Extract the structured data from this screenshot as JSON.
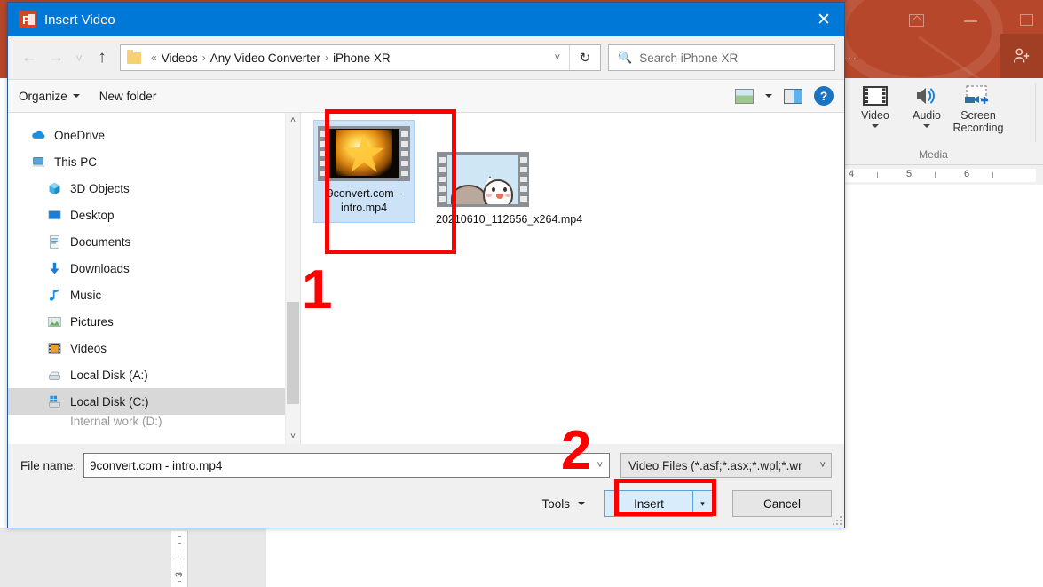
{
  "powerpoint": {
    "ribbon": {
      "group_label": "Media",
      "buttons": [
        {
          "label": "Video",
          "icon": "video-icon",
          "has_caret": true
        },
        {
          "label": "Audio",
          "icon": "audio-speaker-icon",
          "has_caret": true
        },
        {
          "label": "Screen\nRecording",
          "icon": "screen-recording-icon",
          "has_caret": false
        }
      ]
    },
    "ruler": {
      "ticks": [
        "4",
        "5",
        "6"
      ],
      "vertical_tick": "3"
    },
    "window_buttons": [
      "ribbon-display-options",
      "minimize",
      "restore"
    ],
    "account_icon": "person-add-icon",
    "overflow": "···",
    "brand_color": "#b7472a"
  },
  "dialog": {
    "title": "Insert Video",
    "app_icon": "powerpoint-icon",
    "close_label": "✕",
    "titlebar_color": "#0078d7",
    "navigation": {
      "back": "←",
      "forward": "→",
      "recent": "˅",
      "up": "↑",
      "breadcrumb": {
        "prefix": "«",
        "items": [
          "Videos",
          "Any Video Converter",
          "iPhone XR"
        ],
        "separator": "›",
        "chevron": "˅"
      },
      "refresh": "↻",
      "search": {
        "placeholder": "Search iPhone XR",
        "icon": "search-icon"
      }
    },
    "toolbar": {
      "organize": "Organize",
      "new_folder": "New folder",
      "view_icon": "view-options-icon",
      "view_caret": "▾",
      "preview_pane_icon": "preview-pane-icon",
      "help": "?"
    },
    "sidebar": {
      "items": [
        {
          "label": "OneDrive",
          "icon": "onedrive-cloud-icon",
          "indent": false,
          "selected": false
        },
        {
          "label": "This PC",
          "icon": "this-pc-icon",
          "indent": false,
          "selected": false
        },
        {
          "label": "3D Objects",
          "icon": "3d-objects-icon",
          "indent": true,
          "selected": false
        },
        {
          "label": "Desktop",
          "icon": "desktop-icon",
          "indent": true,
          "selected": false
        },
        {
          "label": "Documents",
          "icon": "documents-icon",
          "indent": true,
          "selected": false
        },
        {
          "label": "Downloads",
          "icon": "downloads-icon",
          "indent": true,
          "selected": false
        },
        {
          "label": "Music",
          "icon": "music-note-icon",
          "indent": true,
          "selected": false
        },
        {
          "label": "Pictures",
          "icon": "pictures-icon",
          "indent": true,
          "selected": false
        },
        {
          "label": "Videos",
          "icon": "videos-icon",
          "indent": true,
          "selected": false
        },
        {
          "label": "Local Disk (A:)",
          "icon": "disk-drive-icon",
          "indent": true,
          "selected": false
        },
        {
          "label": "Local Disk (C:)",
          "icon": "windows-disk-icon",
          "indent": true,
          "selected": true
        },
        {
          "label": "Internal work (D:)",
          "icon": "disk-drive-icon",
          "indent": true,
          "selected": false
        }
      ],
      "scroll_up": "˄",
      "scroll_down": "˅"
    },
    "files": [
      {
        "name": "9convert.com - intro.mp4",
        "thumbnail": "star-video-thumbnail",
        "selected": true
      },
      {
        "name": "20210610_112656_x264.mp4",
        "thumbnail": "cat-video-thumbnail",
        "selected": false
      }
    ],
    "footer": {
      "file_name_label": "File name:",
      "file_name_value": "9convert.com - intro.mp4",
      "file_name_chevron": "˅",
      "file_type_value": "Video Files (*.asf;*.asx;*.wpl;*.wr",
      "file_type_chevron": "˅",
      "tools_label": "Tools",
      "tools_caret": "▾",
      "insert_label": "Insert",
      "insert_split_caret": "▾",
      "cancel_label": "Cancel"
    }
  },
  "annotations": [
    {
      "number": "1",
      "target": "selected-file-tile"
    },
    {
      "number": "2",
      "target": "insert-button"
    }
  ]
}
